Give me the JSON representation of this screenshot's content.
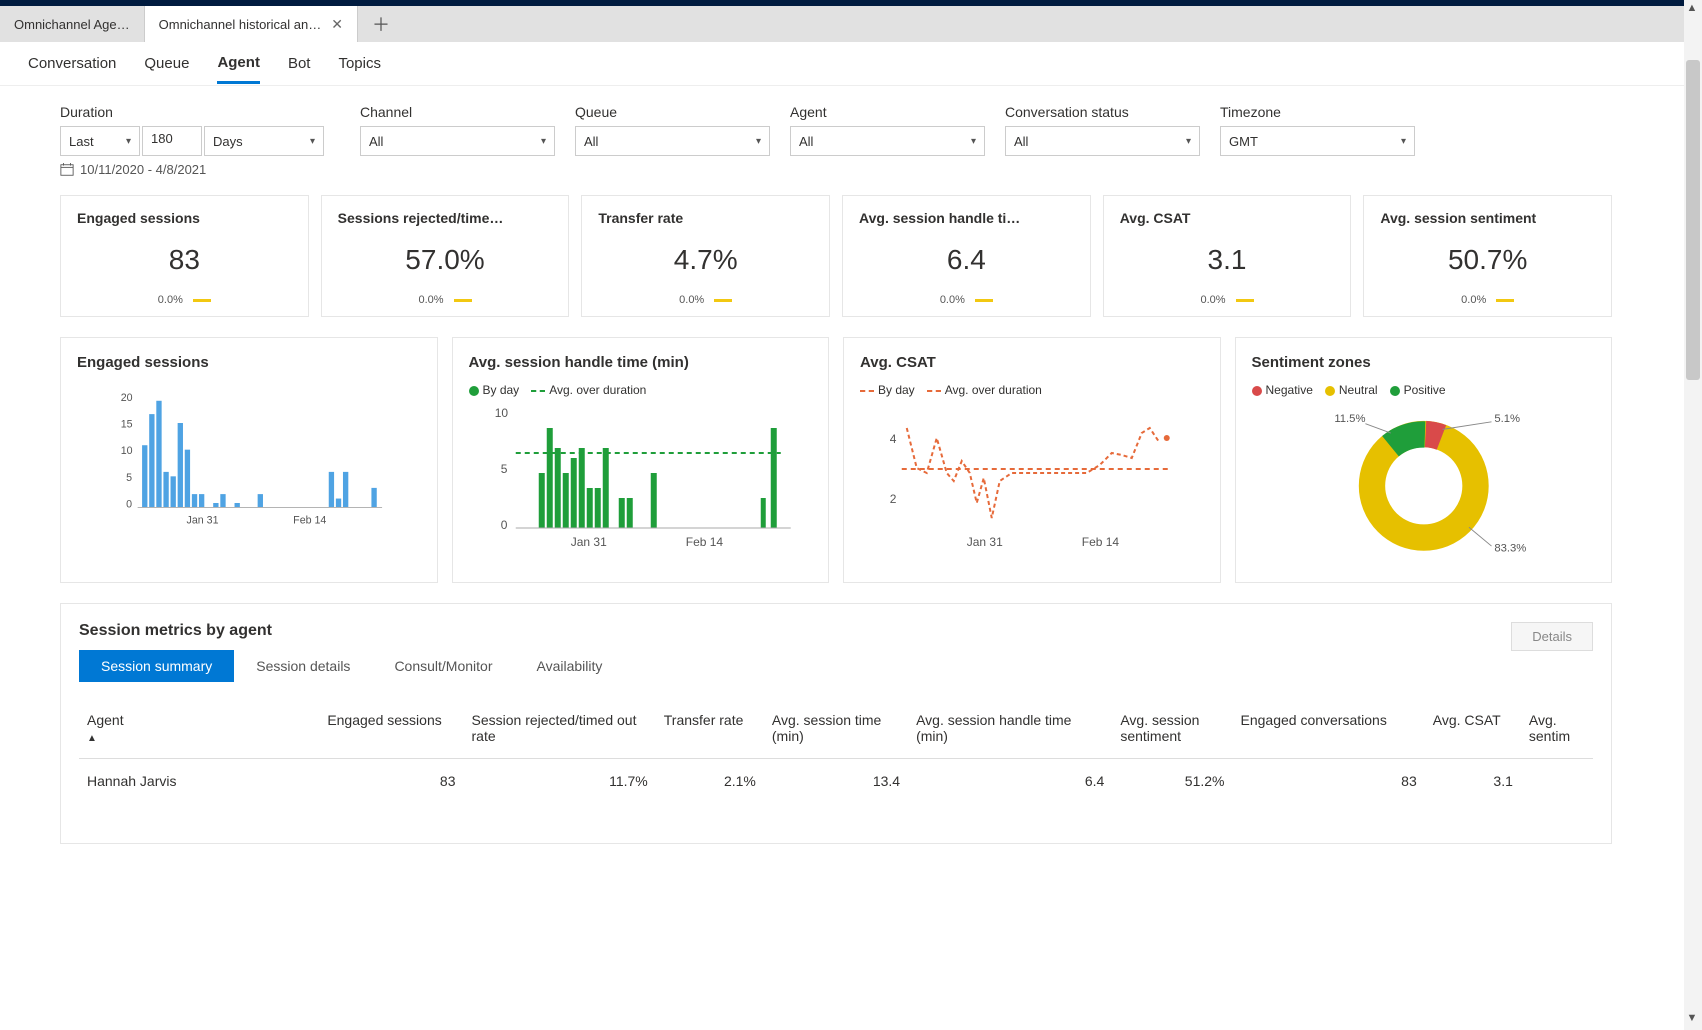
{
  "tabs": {
    "inactive": "Omnichannel Age…",
    "active": "Omnichannel historical an…"
  },
  "subtabs": [
    "Conversation",
    "Queue",
    "Agent",
    "Bot",
    "Topics"
  ],
  "active_subtab": "Agent",
  "filters": {
    "duration": {
      "label": "Duration",
      "mode": "Last",
      "value": "180",
      "unit": "Days"
    },
    "channel": {
      "label": "Channel",
      "value": "All"
    },
    "queue": {
      "label": "Queue",
      "value": "All"
    },
    "agent": {
      "label": "Agent",
      "value": "All"
    },
    "status": {
      "label": "Conversation status",
      "value": "All"
    },
    "timezone": {
      "label": "Timezone",
      "value": "GMT"
    }
  },
  "daterange": "10/11/2020 - 4/8/2021",
  "kpis": [
    {
      "title": "Engaged sessions",
      "value": "83",
      "delta": "0.0%"
    },
    {
      "title": "Sessions rejected/time…",
      "value": "57.0%",
      "delta": "0.0%"
    },
    {
      "title": "Transfer rate",
      "value": "4.7%",
      "delta": "0.0%"
    },
    {
      "title": "Avg. session handle ti…",
      "value": "6.4",
      "delta": "0.0%"
    },
    {
      "title": "Avg. CSAT",
      "value": "3.1",
      "delta": "0.0%"
    },
    {
      "title": "Avg. session sentiment",
      "value": "50.7%",
      "delta": "0.0%"
    }
  ],
  "charts": {
    "engaged": {
      "title": "Engaged sessions",
      "xticks": [
        "Jan 31",
        "Feb 14"
      ],
      "yticks": [
        0,
        5,
        10,
        15,
        20
      ]
    },
    "handle": {
      "title": "Avg. session handle time (min)",
      "legend": {
        "byday": "By day",
        "avg": "Avg. over duration"
      },
      "xticks": [
        "Jan 31",
        "Feb 14"
      ],
      "yticks": [
        0,
        5,
        10
      ]
    },
    "csat": {
      "title": "Avg. CSAT",
      "legend": {
        "byday": "By day",
        "avg": "Avg. over duration"
      },
      "xticks": [
        "Jan 31",
        "Feb 14"
      ],
      "yticks": [
        2,
        4
      ]
    },
    "sentiment": {
      "title": "Sentiment zones",
      "legend": {
        "neg": "Negative",
        "neu": "Neutral",
        "pos": "Positive"
      },
      "labels": {
        "pos": "11.5%",
        "neg": "5.1%",
        "neu": "83.3%"
      }
    }
  },
  "chart_data": [
    {
      "type": "bar",
      "title": "Engaged sessions",
      "x_ticks": [
        "Jan 31",
        "Feb 14"
      ],
      "xlabel": "",
      "ylabel": "",
      "ylim": [
        0,
        22
      ],
      "values": [
        12,
        18,
        20,
        7,
        6,
        16,
        11,
        3,
        3,
        0,
        1,
        3,
        0,
        0,
        1,
        0,
        0,
        3,
        0,
        0,
        0,
        0,
        0,
        0,
        7,
        2,
        7,
        0,
        0,
        0,
        4
      ]
    },
    {
      "type": "bar",
      "title": "Avg. session handle time (min)",
      "x_ticks": [
        "Jan 31",
        "Feb 14"
      ],
      "legend": [
        "By day",
        "Avg. over duration"
      ],
      "xlabel": "",
      "ylabel": "",
      "ylim": [
        0,
        10
      ],
      "series": [
        {
          "name": "By day",
          "values": [
            0,
            0,
            0,
            0,
            5,
            9,
            7,
            5,
            6,
            7,
            4,
            4,
            7,
            0,
            3,
            3,
            0,
            0,
            5,
            0,
            0,
            0,
            0,
            0,
            0,
            0,
            0,
            0,
            0,
            0,
            3,
            9
          ]
        },
        {
          "name": "Avg. over duration",
          "value": 6.4
        }
      ]
    },
    {
      "type": "line",
      "title": "Avg. CSAT",
      "x_ticks": [
        "Jan 31",
        "Feb 14"
      ],
      "legend": [
        "By day",
        "Avg. over duration"
      ],
      "xlabel": "",
      "ylabel": "",
      "ylim": [
        1,
        5
      ],
      "series": [
        {
          "name": "By day",
          "values": [
            4.4,
            3.2,
            3.0,
            4.1,
            3.0,
            2.8,
            3.4,
            3.0,
            2.0,
            2.9,
            1.6,
            2.8,
            3.0,
            3.0,
            3.0,
            3.0,
            3.0,
            3.0,
            3.0,
            3.0,
            3.0,
            3.2,
            3.6,
            3.5,
            3.4,
            4.2,
            4.4,
            3.9
          ]
        },
        {
          "name": "Avg. over duration",
          "value": 3.1
        }
      ]
    },
    {
      "type": "pie",
      "title": "Sentiment zones",
      "legend": [
        "Negative",
        "Neutral",
        "Positive"
      ],
      "slices": [
        {
          "name": "Negative",
          "value": 5.1
        },
        {
          "name": "Neutral",
          "value": 83.3
        },
        {
          "name": "Positive",
          "value": 11.5
        }
      ]
    }
  ],
  "table": {
    "title": "Session metrics by agent",
    "details_btn": "Details",
    "view_tabs": [
      "Session summary",
      "Session details",
      "Consult/Monitor",
      "Availability"
    ],
    "active_view": "Session summary",
    "columns": [
      "Agent",
      "Engaged sessions",
      "Session rejected/timed out rate",
      "Transfer rate",
      "Avg. session time (min)",
      "Avg. session handle time (min)",
      "Avg. session sentiment",
      "Engaged conversations",
      "Avg. CSAT",
      "Avg. sentim"
    ],
    "rows": [
      {
        "agent": "Hannah Jarvis",
        "engaged": "83",
        "rejected": "11.7%",
        "transfer": "2.1%",
        "sess_time": "13.4",
        "handle_time": "6.4",
        "sentiment": "51.2%",
        "conv": "83",
        "csat": "3.1"
      }
    ]
  }
}
